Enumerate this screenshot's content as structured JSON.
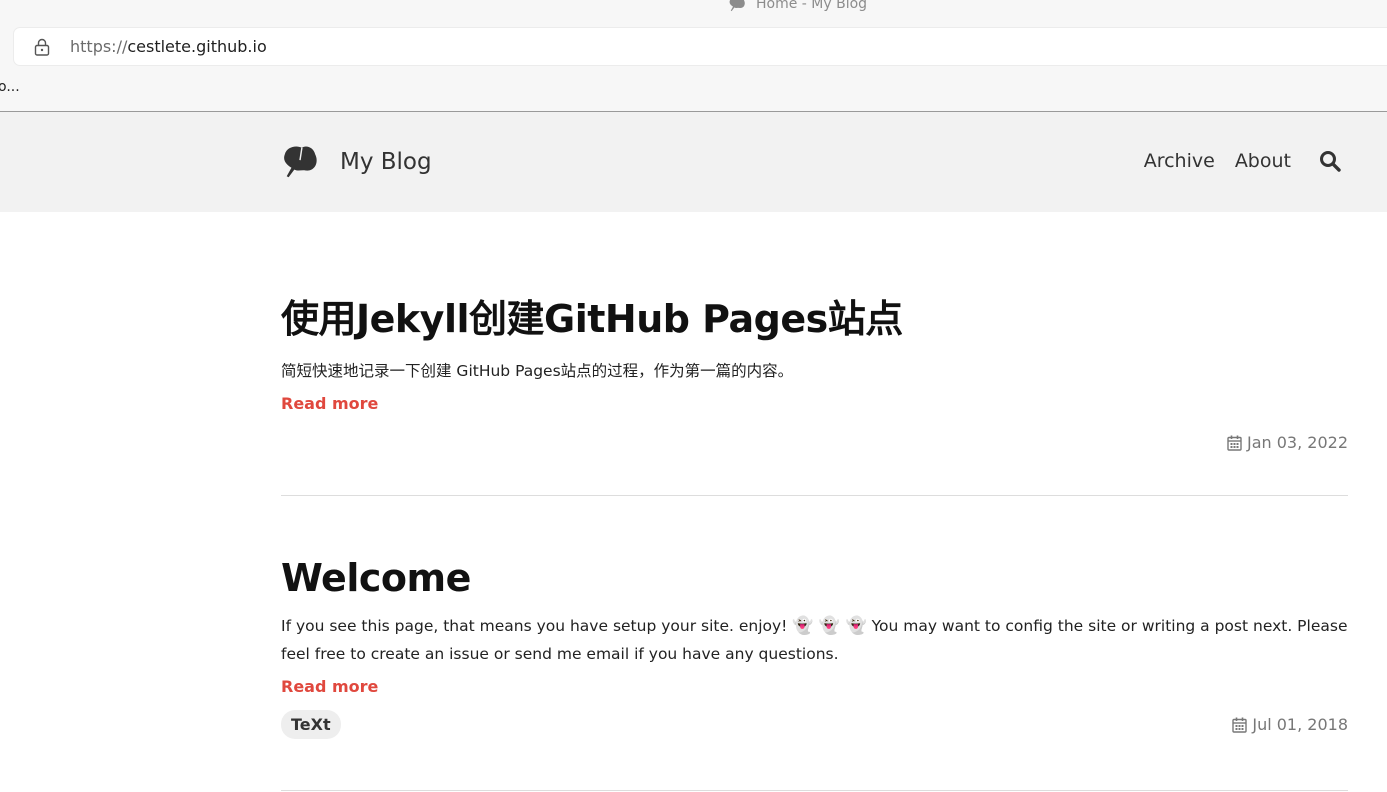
{
  "browser": {
    "tab_title": "Home - My Blog",
    "url_scheme": "https://",
    "url_host": "cestlete.github.io",
    "status_text": "o..."
  },
  "site": {
    "name": "My Blog",
    "nav": [
      {
        "label": "Archive"
      },
      {
        "label": "About"
      }
    ],
    "search_icon": "search-icon",
    "logo_icon": "ginkgo-leaf-icon"
  },
  "posts": [
    {
      "title": "使用Jekyll创建GitHub Pages站点",
      "excerpt": "简短快速地记录一下创建 GitHub Pages站点的过程，作为第一篇的内容。",
      "read_more": "Read more",
      "date": "Jan 03, 2022",
      "tags": []
    },
    {
      "title": "Welcome",
      "excerpt_before": "If you see this page, that means you have setup your site. enjoy!",
      "emojis": "👻 👻 👻",
      "excerpt_after": "You may want to config the site or writing a post next. Please feel free to create an issue or send me email if you have any questions.",
      "read_more": "Read more",
      "date": "Jul 01, 2018",
      "tags": [
        "TeXt"
      ]
    }
  ],
  "colors": {
    "accent": "#e0483e",
    "header_bg": "#f2f2f2",
    "meta": "#777777"
  }
}
